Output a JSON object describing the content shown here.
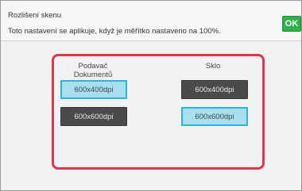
{
  "header": {
    "title": "Rozlišení skenu",
    "subtitle": "Toto nastavení se aplikuje, když je měřítko nastaveno na 100%.",
    "ok_label": "OK"
  },
  "columns": {
    "feeder_label": "Podavač Dokumentů",
    "glass_label": "Sklo"
  },
  "options": {
    "feeder_400": "600x400dpi",
    "feeder_600": "600x600dpi",
    "glass_400": "600x400dpi",
    "glass_600": "600x600dpi"
  },
  "selection": {
    "feeder": "600x400dpi",
    "glass": "600x600dpi"
  },
  "colors": {
    "ok_button": "#2eb24a",
    "highlight_border": "#e0354c",
    "selected_fill": "#a8dff0",
    "unselected_fill": "#4a4a4a"
  }
}
